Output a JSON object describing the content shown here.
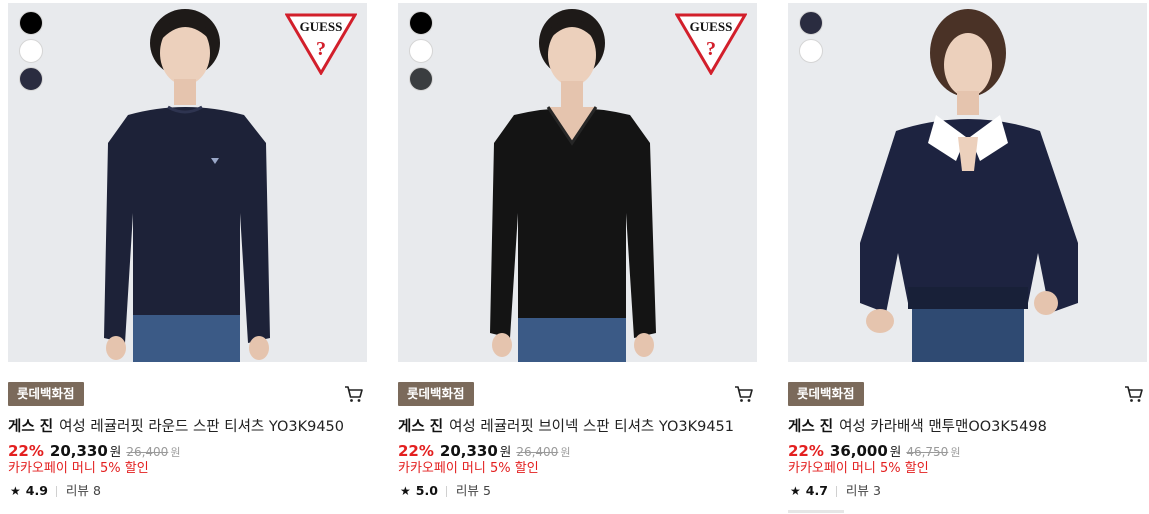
{
  "products": [
    {
      "store_label": "롯데백화점",
      "brand": "게스 진",
      "name": "여성 레귤러핏 라운드 스판 티셔츠 YO3K9450",
      "discount": "22%",
      "price": "20,330",
      "price_unit": "원",
      "original_price": "26,400",
      "original_unit": "원",
      "promo": "카카오페이 머니 5% 할인",
      "rating": "4.9",
      "review_label": "리뷰",
      "review_count": "8",
      "swatches": [
        "#000000",
        "#ffffff",
        "#2a2c40"
      ],
      "logo_text": "GUESS",
      "has_logo": true
    },
    {
      "store_label": "롯데백화점",
      "brand": "게스 진",
      "name": "여성 레귤러핏 브이넥 스판 티셔츠 YO3K9451",
      "discount": "22%",
      "price": "20,330",
      "price_unit": "원",
      "original_price": "26,400",
      "original_unit": "원",
      "promo": "카카오페이 머니 5% 할인",
      "rating": "5.0",
      "review_label": "리뷰",
      "review_count": "5",
      "swatches": [
        "#000000",
        "#ffffff",
        "#3a3d40"
      ],
      "logo_text": "GUESS",
      "has_logo": true
    },
    {
      "store_label": "롯데백화점",
      "brand": "게스 진",
      "name": "여성 카라배색 맨투맨OO3K5498",
      "discount": "22%",
      "price": "36,000",
      "price_unit": "원",
      "original_price": "46,750",
      "original_unit": "원",
      "promo": "카카오페이 머니 5% 할인",
      "rating": "4.7",
      "review_label": "리뷰",
      "review_count": "3",
      "swatches": [
        "#2a2c40",
        "#ffffff"
      ],
      "has_logo": false
    }
  ],
  "colors": {
    "discount": "#e32020",
    "store_badge": "#7b6a5b",
    "image_bg": "#e8eaed"
  }
}
